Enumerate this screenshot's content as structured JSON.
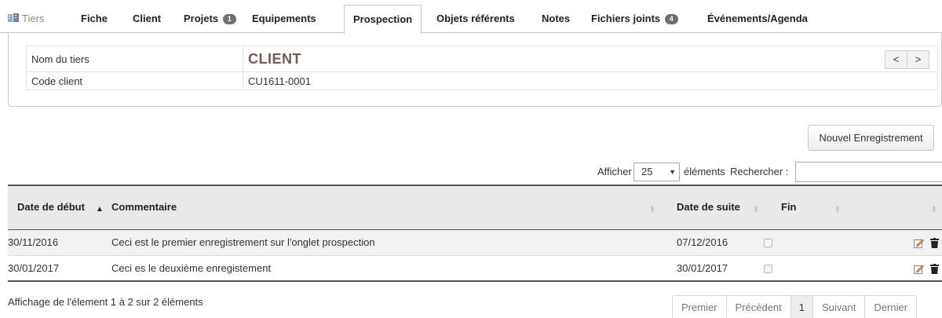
{
  "tabs": [
    {
      "label": "Tiers"
    },
    {
      "label": "Fiche"
    },
    {
      "label": "Client"
    },
    {
      "label": "Projets",
      "badge": "1"
    },
    {
      "label": "Equipements"
    },
    {
      "label": "Prospection",
      "active": true
    },
    {
      "label": "Objets référents"
    },
    {
      "label": "Notes"
    },
    {
      "label": "Fichiers joints",
      "badge": "4"
    },
    {
      "label": "Événements/Agenda"
    }
  ],
  "info": {
    "name_label": "Nom du tiers",
    "name_value": "CLIENT",
    "code_label": "Code client",
    "code_value": "CU1611-0001",
    "prev_label": "<",
    "next_label": ">"
  },
  "new_button": "Nouvel Enregistrement",
  "length_control": {
    "show_label": "Afficher",
    "value": "25",
    "items_label": "éléments"
  },
  "search": {
    "label": "Rechercher :",
    "value": ""
  },
  "table": {
    "columns": [
      "Date de début",
      "Commentaire",
      "Date de suite",
      "Fin"
    ],
    "rows": [
      {
        "start": "30/11/2016",
        "comment": "Ceci est le premier enregistrement sur l'onglet prospection",
        "next": "07/12/2016",
        "done": false
      },
      {
        "start": "30/01/2017",
        "comment": "Ceci es le deuxième enregistement",
        "next": "30/01/2017",
        "done": false
      }
    ]
  },
  "footer": {
    "info": "Affichage de l'élement 1 à 2 sur 2 éléments",
    "pager": {
      "first": "Premier",
      "prev": "Précédent",
      "current": "1",
      "next": "Suivant",
      "last": "Dernier"
    }
  },
  "colors": {
    "client_name": "#7a5a52",
    "header_bg": "#e9e9e9",
    "badge_bg": "#6f6f6f"
  },
  "icons": {
    "tiers": "tiers-icon",
    "edit": "edit-icon",
    "delete": "trash-icon",
    "sort": "sort-icon"
  }
}
